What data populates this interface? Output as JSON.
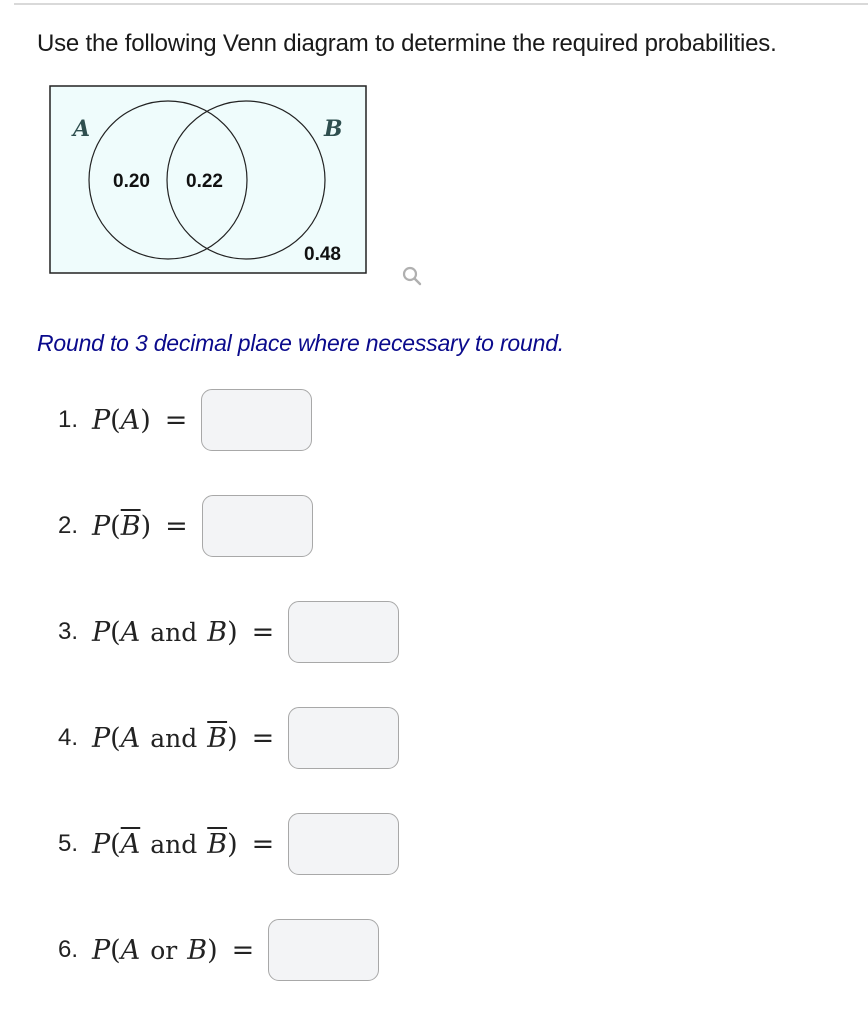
{
  "intro": "Use the following Venn diagram to determine the required probabilities.",
  "venn": {
    "set_a_label": "A",
    "set_b_label": "B",
    "a_only": "0.20",
    "a_and_b": "0.22",
    "b_only": "",
    "outside": "0.48",
    "background_color": "#effcfc",
    "label_color": "#2f4f4f"
  },
  "zoom_icon": "magnifier-icon",
  "note": "Round to 3 decimal place where necessary to round.",
  "questions": [
    {
      "num": "1.",
      "p": "P",
      "lparen": "(",
      "a": "A",
      "rparen": ")",
      "eq": "=",
      "answer": ""
    },
    {
      "num": "2.",
      "p": "P",
      "lparen": "(",
      "b": "B",
      "rparen": ")",
      "eq": "=",
      "answer": ""
    },
    {
      "num": "3.",
      "p": "P",
      "lparen": "(",
      "a": "A",
      "op": "and",
      "b": "B",
      "rparen": ")",
      "eq": "=",
      "answer": ""
    },
    {
      "num": "4.",
      "p": "P",
      "lparen": "(",
      "a": "A",
      "op": "and",
      "b": "B",
      "rparen": ")",
      "eq": "=",
      "answer": ""
    },
    {
      "num": "5.",
      "p": "P",
      "lparen": "(",
      "a": "A",
      "op": "and",
      "b": "B",
      "rparen": ")",
      "eq": "=",
      "answer": ""
    },
    {
      "num": "6.",
      "p": "P",
      "lparen": "(",
      "a": "A",
      "op": "or",
      "b": "B",
      "rparen": ")",
      "eq": "=",
      "answer": ""
    }
  ]
}
